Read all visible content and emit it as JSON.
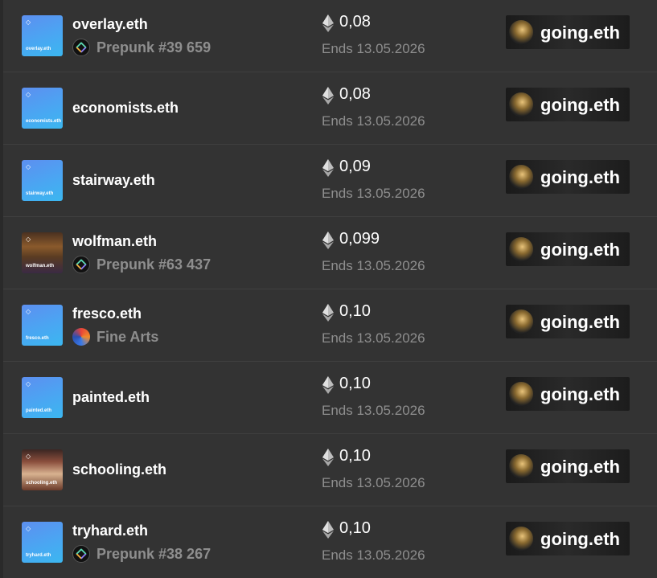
{
  "listings": [
    {
      "name": "overlay.eth",
      "thumb_label": "overlay.eth",
      "thumb_style": "gradient",
      "collection": "Prepunk #39 659",
      "collection_icon": "prepunk-icon",
      "price": "0,08",
      "ends": "Ends 13.05.2026",
      "seller": "going.eth"
    },
    {
      "name": "economists.eth",
      "thumb_label": "economists.eth",
      "thumb_style": "gradient",
      "collection": "",
      "collection_icon": "",
      "price": "0,08",
      "ends": "Ends 13.05.2026",
      "seller": "going.eth"
    },
    {
      "name": "stairway.eth",
      "thumb_label": "stairway.eth",
      "thumb_style": "gradient",
      "collection": "",
      "collection_icon": "",
      "price": "0,09",
      "ends": "Ends 13.05.2026",
      "seller": "going.eth"
    },
    {
      "name": "wolfman.eth",
      "thumb_label": "wolfman.eth",
      "thumb_style": "photo-wolf",
      "collection": "Prepunk #63 437",
      "collection_icon": "prepunk-icon",
      "price": "0,099",
      "ends": "Ends 13.05.2026",
      "seller": "going.eth"
    },
    {
      "name": "fresco.eth",
      "thumb_label": "fresco.eth",
      "thumb_style": "gradient",
      "collection": "Fine Arts",
      "collection_icon": "fine-arts-icon",
      "price": "0,10",
      "ends": "Ends 13.05.2026",
      "seller": "going.eth"
    },
    {
      "name": "painted.eth",
      "thumb_label": "painted.eth",
      "thumb_style": "gradient",
      "collection": "",
      "collection_icon": "",
      "price": "0,10",
      "ends": "Ends 13.05.2026",
      "seller": "going.eth"
    },
    {
      "name": "schooling.eth",
      "thumb_label": "schooling.eth",
      "thumb_style": "photo-school",
      "collection": "",
      "collection_icon": "",
      "price": "0,10",
      "ends": "Ends 13.05.2026",
      "seller": "going.eth"
    },
    {
      "name": "tryhard.eth",
      "thumb_label": "tryhard.eth",
      "thumb_style": "gradient",
      "collection": "Prepunk #38 267",
      "collection_icon": "prepunk-icon",
      "price": "0,10",
      "ends": "Ends 13.05.2026",
      "seller": "going.eth"
    }
  ],
  "colors": {
    "background": "#333333",
    "divider": "#3f3f3f",
    "text_primary": "#ffffff",
    "text_secondary": "#8e8e8e",
    "ens_gradient_start": "#5d8ff0",
    "ens_gradient_end": "#3bb7f0"
  },
  "icons": {
    "price_icon": "ethereum-icon",
    "thumb_logo": "ens-logo-icon"
  }
}
